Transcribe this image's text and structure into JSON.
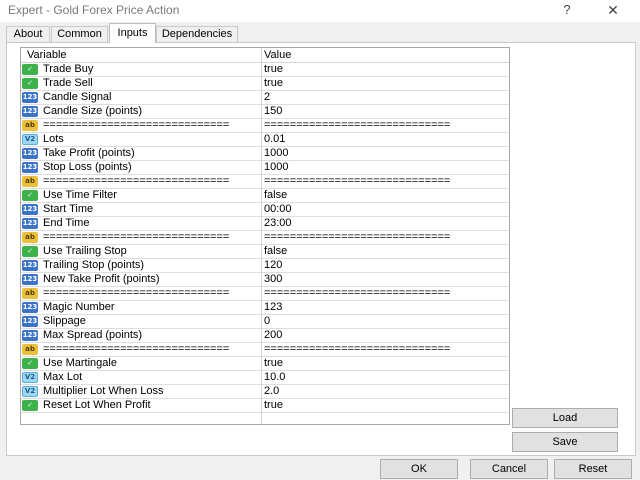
{
  "window": {
    "title": "Expert - Gold Forex Price Action",
    "help": "?",
    "close": "✕"
  },
  "tabs": [
    "About",
    "Common",
    "Inputs",
    "Dependencies"
  ],
  "active_tab": "Inputs",
  "grid": {
    "headers": {
      "variable": "Variable",
      "value": "Value"
    },
    "rows": [
      {
        "type": "bool",
        "name": "Trade Buy",
        "value": "true"
      },
      {
        "type": "bool",
        "name": "Trade Sell",
        "value": "true"
      },
      {
        "type": "int",
        "name": "Candle Signal",
        "value": "2"
      },
      {
        "type": "int",
        "name": "Candle Size (points)",
        "value": "150"
      },
      {
        "type": "str",
        "name": "=============================",
        "value": "============================="
      },
      {
        "type": "dbl",
        "name": "Lots",
        "value": "0.01"
      },
      {
        "type": "int",
        "name": "Take Profit (points)",
        "value": "1000"
      },
      {
        "type": "int",
        "name": "Stop Loss (points)",
        "value": "1000"
      },
      {
        "type": "str",
        "name": "=============================",
        "value": "============================="
      },
      {
        "type": "bool",
        "name": "Use Time Filter",
        "value": "false"
      },
      {
        "type": "int",
        "name": "Start Time",
        "value": "00:00"
      },
      {
        "type": "int",
        "name": "End Time",
        "value": "23:00"
      },
      {
        "type": "str",
        "name": "=============================",
        "value": "============================="
      },
      {
        "type": "bool",
        "name": "Use Trailing Stop",
        "value": "false"
      },
      {
        "type": "int",
        "name": "Trailing Stop (points)",
        "value": "120"
      },
      {
        "type": "int",
        "name": "New Take Profit (points)",
        "value": "300"
      },
      {
        "type": "str",
        "name": "=============================",
        "value": "============================="
      },
      {
        "type": "int",
        "name": "Magic Number",
        "value": "123"
      },
      {
        "type": "int",
        "name": "Slippage",
        "value": "0"
      },
      {
        "type": "int",
        "name": "Max Spread (points)",
        "value": "200"
      },
      {
        "type": "str",
        "name": "=============================",
        "value": "============================="
      },
      {
        "type": "bool",
        "name": "Use Martingale",
        "value": "true"
      },
      {
        "type": "dbl",
        "name": "Max Lot",
        "value": "10.0"
      },
      {
        "type": "dbl",
        "name": "Multiplier Lot When Loss",
        "value": "2.0"
      },
      {
        "type": "bool",
        "name": "Reset Lot When Profit",
        "value": "true"
      }
    ]
  },
  "icon_labels": {
    "bool": "✓",
    "int": "123",
    "dbl": "V2",
    "str": "ab"
  },
  "buttons": {
    "load": "Load",
    "save": "Save",
    "ok": "OK",
    "cancel": "Cancel",
    "reset": "Reset"
  }
}
